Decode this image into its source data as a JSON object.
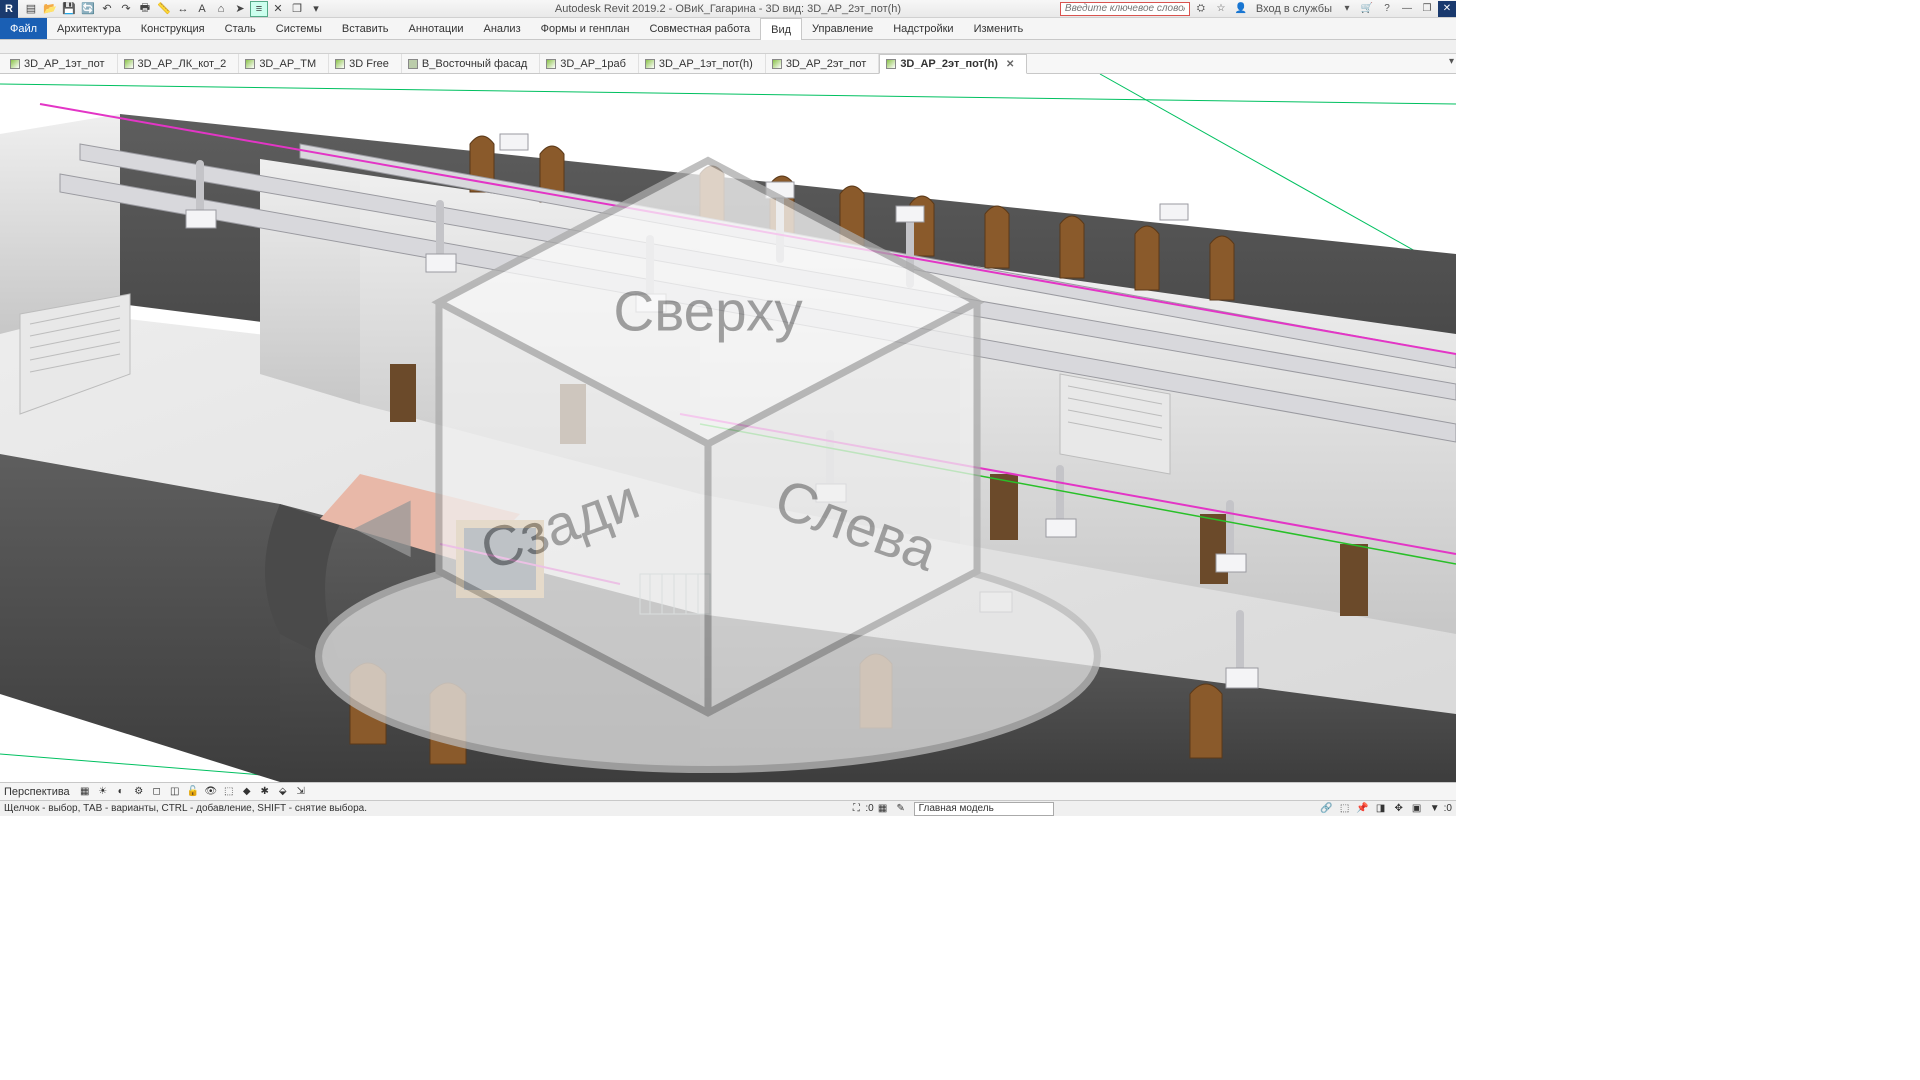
{
  "app": {
    "title": "Autodesk Revit 2019.2 - ОВиК_Гагарина - 3D вид: 3D_АР_2эт_пот(h)",
    "logo": "R"
  },
  "search": {
    "placeholder": "Введите ключевое слово/фразу"
  },
  "user": {
    "login_label": "Вход в службы",
    "star": "☆",
    "person": "👤"
  },
  "qat": {
    "items": [
      "file-icon",
      "open-icon",
      "save-icon",
      "sync-icon",
      "undo-icon",
      "redo-icon",
      "print-icon",
      "measure-icon",
      "align-icon",
      "text-icon",
      "home-icon",
      "thin-lines-icon",
      "close-hidden-icon",
      "switch-icon",
      "dropdown-qat-icon"
    ]
  },
  "ribbon": {
    "file": "Файл",
    "tabs": [
      {
        "label": "Архитектура",
        "id": "arch"
      },
      {
        "label": "Конструкция",
        "id": "struct"
      },
      {
        "label": "Сталь",
        "id": "steel"
      },
      {
        "label": "Системы",
        "id": "systems"
      },
      {
        "label": "Вставить",
        "id": "insert"
      },
      {
        "label": "Аннотации",
        "id": "annot"
      },
      {
        "label": "Анализ",
        "id": "analyze"
      },
      {
        "label": "Формы и генплан",
        "id": "massing"
      },
      {
        "label": "Совместная работа",
        "id": "collab"
      },
      {
        "label": "Вид",
        "id": "view",
        "active": true
      },
      {
        "label": "Управление",
        "id": "manage"
      },
      {
        "label": "Надстройки",
        "id": "addins"
      },
      {
        "label": "Изменить",
        "id": "modify"
      }
    ]
  },
  "viewtabs": {
    "items": [
      {
        "label": "3D_АР_1эт_пот",
        "icon": "cube"
      },
      {
        "label": "3D_АР_ЛК_кот_2",
        "icon": "cube"
      },
      {
        "label": "3D_АР_ТМ",
        "icon": "cube"
      },
      {
        "label": "3D Free",
        "icon": "cube"
      },
      {
        "label": "В_Восточный фасад",
        "icon": "house"
      },
      {
        "label": "3D_АР_1раб",
        "icon": "cube"
      },
      {
        "label": "3D_АР_1эт_пот(h)",
        "icon": "cube"
      },
      {
        "label": "3D_АР_2эт_пот",
        "icon": "cube"
      },
      {
        "label": "3D_АР_2эт_пот(h)",
        "icon": "cube",
        "active": true
      }
    ]
  },
  "viewcontrol": {
    "label": "Перспектива",
    "icons": [
      "graphic-display-icon",
      "sun-icon",
      "shadows-icon",
      "render-icon",
      "crop-icon",
      "crop-visible-icon",
      "lock-icon",
      "temp-hide-icon",
      "reveal-icon",
      "constraints-icon",
      "analytic-icon",
      "highlight-icon",
      "link-display-icon"
    ]
  },
  "status": {
    "hint": "Щелчок - выбор, ТАВ - варианты, CTRL - добавление, SHIFT - снятие выбора.",
    "model_selector": "Главная модель",
    "right_icons": [
      "select-links-icon",
      "select-underlay-icon",
      "select-pinned-icon",
      "select-face-icon",
      "drag-icon",
      "filter-icon",
      "count-icon"
    ],
    "mid_icons": [
      "press-drag-icon",
      "editable-icon",
      "worksets-icon",
      "design-options-icon"
    ],
    "zero": ":0"
  },
  "viewcube": {
    "faces": {
      "top": "Сверху",
      "front": "Сзади",
      "right": "Слева"
    }
  }
}
